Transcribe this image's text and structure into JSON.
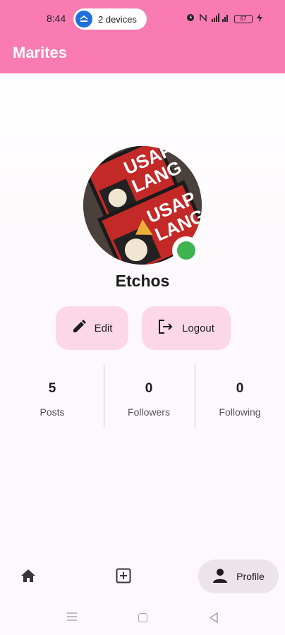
{
  "status_bar": {
    "time": "8:44",
    "devices_label": "2 devices",
    "battery": "67"
  },
  "app_bar": {
    "title": "Marites"
  },
  "profile": {
    "username": "Etchos",
    "online": true,
    "avatar_text_1": "USAP",
    "avatar_text_2": "LANG"
  },
  "actions": {
    "edit_label": "Edit",
    "logout_label": "Logout"
  },
  "stats": [
    {
      "value": "5",
      "label": "Posts"
    },
    {
      "value": "0",
      "label": "Followers"
    },
    {
      "value": "0",
      "label": "Following"
    }
  ],
  "bottom_nav": {
    "profile_label": "Profile",
    "selected": "profile"
  },
  "colors": {
    "primary": "#f97bb2",
    "button_bg": "#fcd8e6",
    "online": "#3fb34f",
    "nav_selected_bg": "#ede4ea"
  }
}
